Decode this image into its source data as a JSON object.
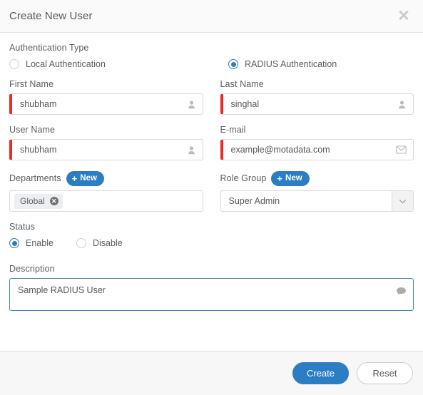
{
  "dialog": {
    "title": "Create New User",
    "close_icon": "close-icon"
  },
  "auth": {
    "label": "Authentication Type",
    "options": [
      {
        "label": "Local Authentication",
        "selected": false
      },
      {
        "label": "RADIUS Authentication",
        "selected": true
      }
    ]
  },
  "fields": {
    "first_name": {
      "label": "First Name",
      "value": "shubham",
      "placeholder": "First Name",
      "icon": "user-icon",
      "required": true
    },
    "last_name": {
      "label": "Last Name",
      "value": "singhal",
      "placeholder": "Last Name",
      "icon": "user-icon",
      "required": true
    },
    "user_name": {
      "label": "User Name",
      "value": "shubham",
      "placeholder": "User Name",
      "icon": "user-icon",
      "required": true
    },
    "email": {
      "label": "E-mail",
      "value": "example@motadata.com",
      "placeholder": "E-mail",
      "icon": "envelope-icon",
      "required": true
    },
    "departments": {
      "label": "Departments",
      "new_button": "New",
      "tags": [
        "Global"
      ]
    },
    "role_group": {
      "label": "Role Group",
      "new_button": "New",
      "value": "Super Admin"
    },
    "status": {
      "label": "Status",
      "options": [
        {
          "label": "Enable",
          "selected": true
        },
        {
          "label": "Disable",
          "selected": false
        }
      ]
    },
    "description": {
      "label": "Description",
      "value": "Sample RADIUS User",
      "placeholder": "Description",
      "icon": "comment-icon"
    }
  },
  "footer": {
    "create_label": "Create",
    "reset_label": "Reset"
  },
  "colors": {
    "accent": "#2b7dc4",
    "required": "#ee2a24",
    "focus_border": "#3b86c8",
    "footer_bg": "#f7f7f8"
  }
}
